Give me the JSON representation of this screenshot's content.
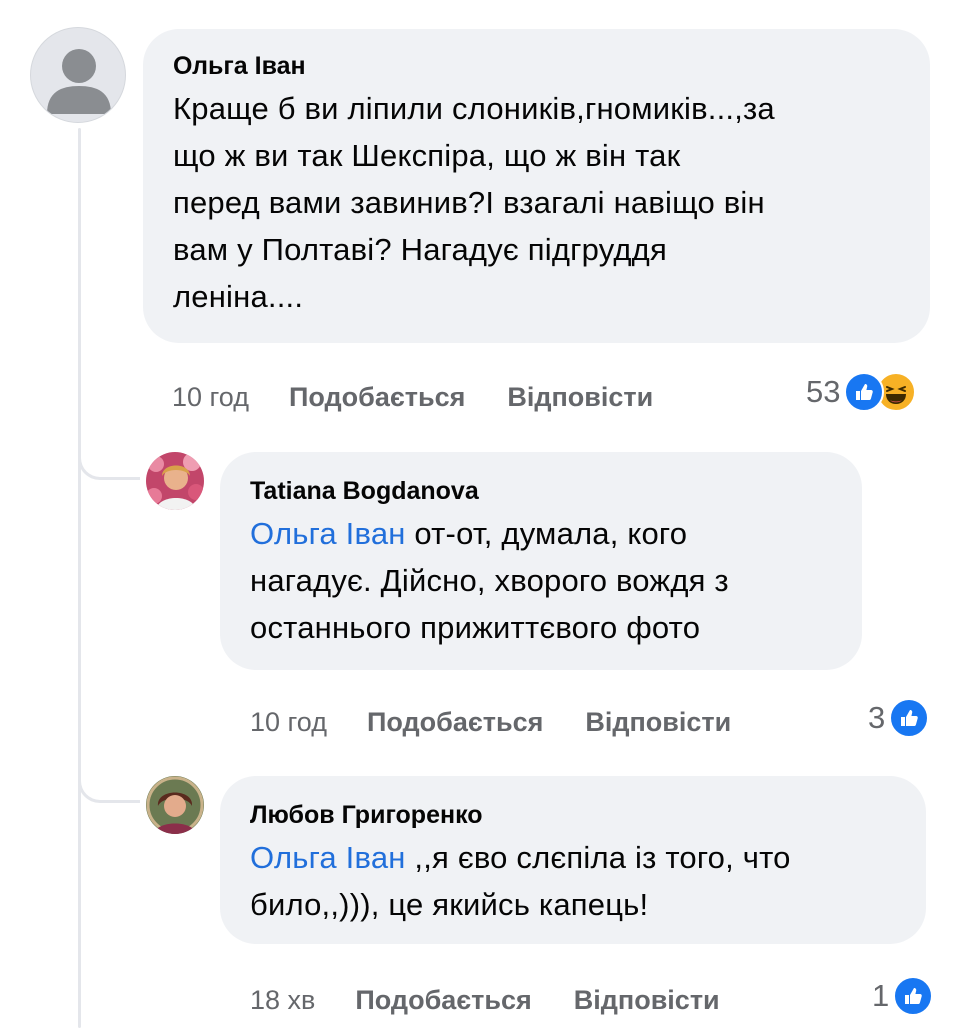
{
  "comments": [
    {
      "author": "Ольга Іван",
      "text_lines": [
        "Краще б ви ліпили слоників,гномиків...,за",
        "що ж ви так Шекспіра, що ж він так",
        "перед вами завинив?І взагалі навіщо він",
        "вам у Полтаві? Нагадує підгруддя",
        "леніна...."
      ],
      "time": "10 год",
      "like_label": "Подобається",
      "reply_label": "Відповісти",
      "reaction_count": "53",
      "reactions": [
        "like-icon",
        "haha-icon"
      ]
    }
  ],
  "replies": [
    {
      "author": "Tatiana Bogdanova",
      "mention": "Ольга Іван",
      "text_lines": [
        " от-от, думала, кого",
        "нагадує. Дійсно, хворого вождя з",
        "останнього прижиттєвого фото"
      ],
      "time": "10 год",
      "like_label": "Подобається",
      "reply_label": "Відповісти",
      "reaction_count": "3",
      "reactions": [
        "like-icon"
      ]
    },
    {
      "author": "Любов Григоренко",
      "mention": "Ольга Іван",
      "text_lines": [
        " ,,я єво слєпіла із того, что",
        "било,,))), це якийсь капець!"
      ],
      "time": "18 хв",
      "like_label": "Подобається",
      "reply_label": "Відповісти",
      "reaction_count": "1",
      "reactions": [
        "like-icon"
      ]
    }
  ],
  "colors": {
    "bubble": "#f0f2f5",
    "mention": "#216fdb",
    "meta": "#65676b",
    "like": "#1877f2",
    "haha": "#f7b125"
  }
}
